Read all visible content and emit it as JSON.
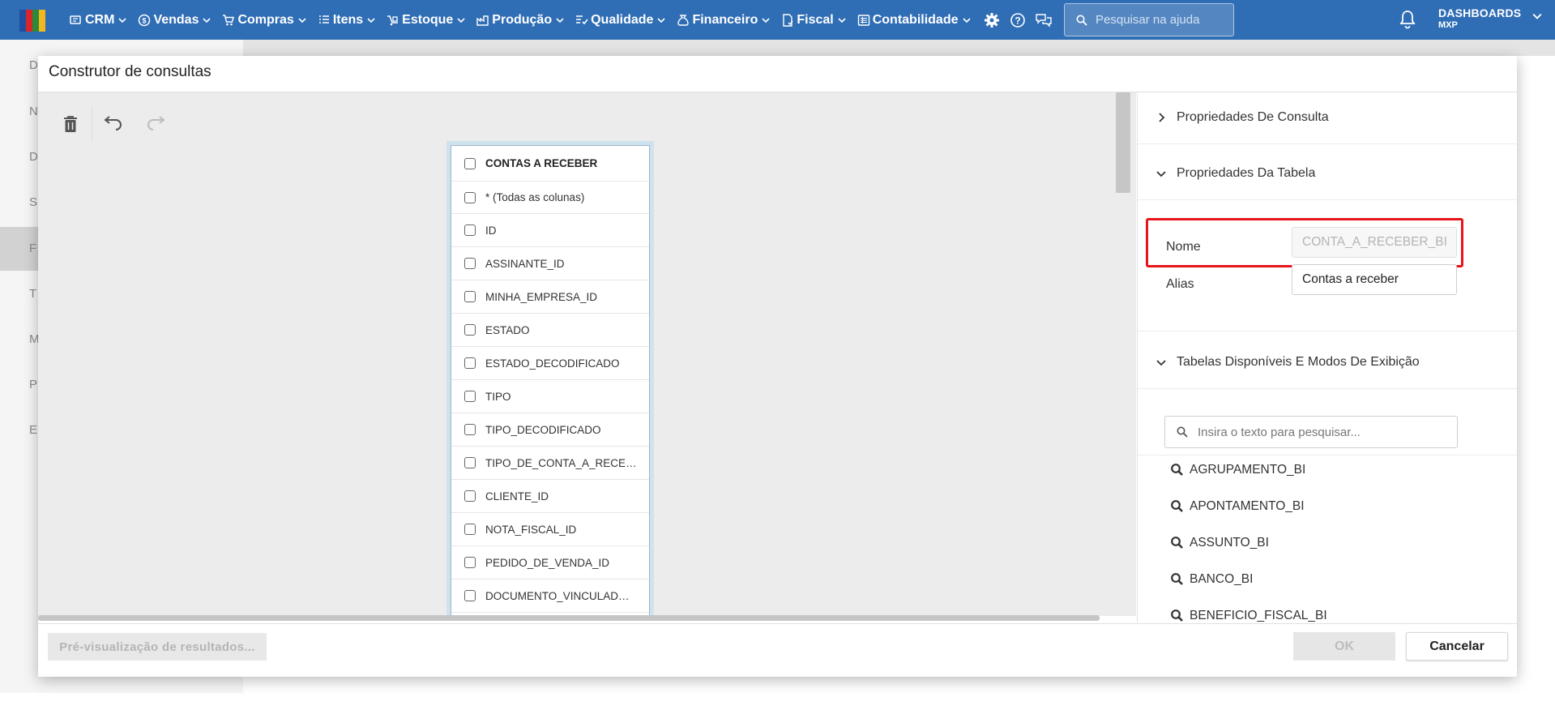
{
  "topbar": {
    "logo_colors": [
      "#1f4fa3",
      "#d8262b",
      "#2a8a3a",
      "#f2b81d"
    ],
    "menu": [
      {
        "label": "CRM",
        "icon": "crm-icon"
      },
      {
        "label": "Vendas",
        "icon": "dollar-circle-icon"
      },
      {
        "label": "Compras",
        "icon": "cart-icon"
      },
      {
        "label": "Itens",
        "icon": "items-icon"
      },
      {
        "label": "Estoque",
        "icon": "stock-icon"
      },
      {
        "label": "Produção",
        "icon": "factory-icon"
      },
      {
        "label": "Qualidade",
        "icon": "quality-icon"
      },
      {
        "label": "Financeiro",
        "icon": "money-bag-icon"
      },
      {
        "label": "Fiscal",
        "icon": "document-icon"
      },
      {
        "label": "Contabilidade",
        "icon": "ledger-icon"
      }
    ],
    "help_search_placeholder": "Pesquisar na ajuda",
    "dashboards_label": "DASHBOARDS",
    "dashboards_sub": "MXP",
    "accent": "#2f6db5"
  },
  "background_sidebar": [
    "D",
    "N",
    "D",
    "S",
    "F",
    "T",
    "M",
    "P",
    "E"
  ],
  "dialog": {
    "title": "Construtor de consultas",
    "table": {
      "name": "CONTAS A RECEBER",
      "columns": [
        "* (Todas as colunas)",
        "ID",
        "ASSINANTE_ID",
        "MINHA_EMPRESA_ID",
        "ESTADO",
        "ESTADO_DECODIFICADO",
        "TIPO",
        "TIPO_DECODIFICADO",
        "TIPO_DE_CONTA_A_RECEBE...",
        "CLIENTE_ID",
        "NOTA_FISCAL_ID",
        "PEDIDO_DE_VENDA_ID",
        "DOCUMENTO_VINCULADO_..."
      ]
    },
    "panel": {
      "query_props": "Propriedades De Consulta",
      "table_props": "Propriedades Da Tabela",
      "name_label": "Nome",
      "name_value": "CONTA_A_RECEBER_BI",
      "alias_label": "Alias",
      "alias_value": "Contas a receber",
      "available_tables": "Tabelas Disponíveis E Modos De Exibição",
      "search_placeholder": "Insira o texto para pesquisar...",
      "tables": [
        "AGRUPAMENTO_BI",
        "APONTAMENTO_BI",
        "ASSUNTO_BI",
        "BANCO_BI",
        "BENEFICIO_FISCAL_BI"
      ],
      "highlight_color": "#e8141c"
    },
    "footer": {
      "preview_label": "Pré-visualização de resultados...",
      "ok_label": "OK",
      "cancel_label": "Cancelar"
    }
  }
}
